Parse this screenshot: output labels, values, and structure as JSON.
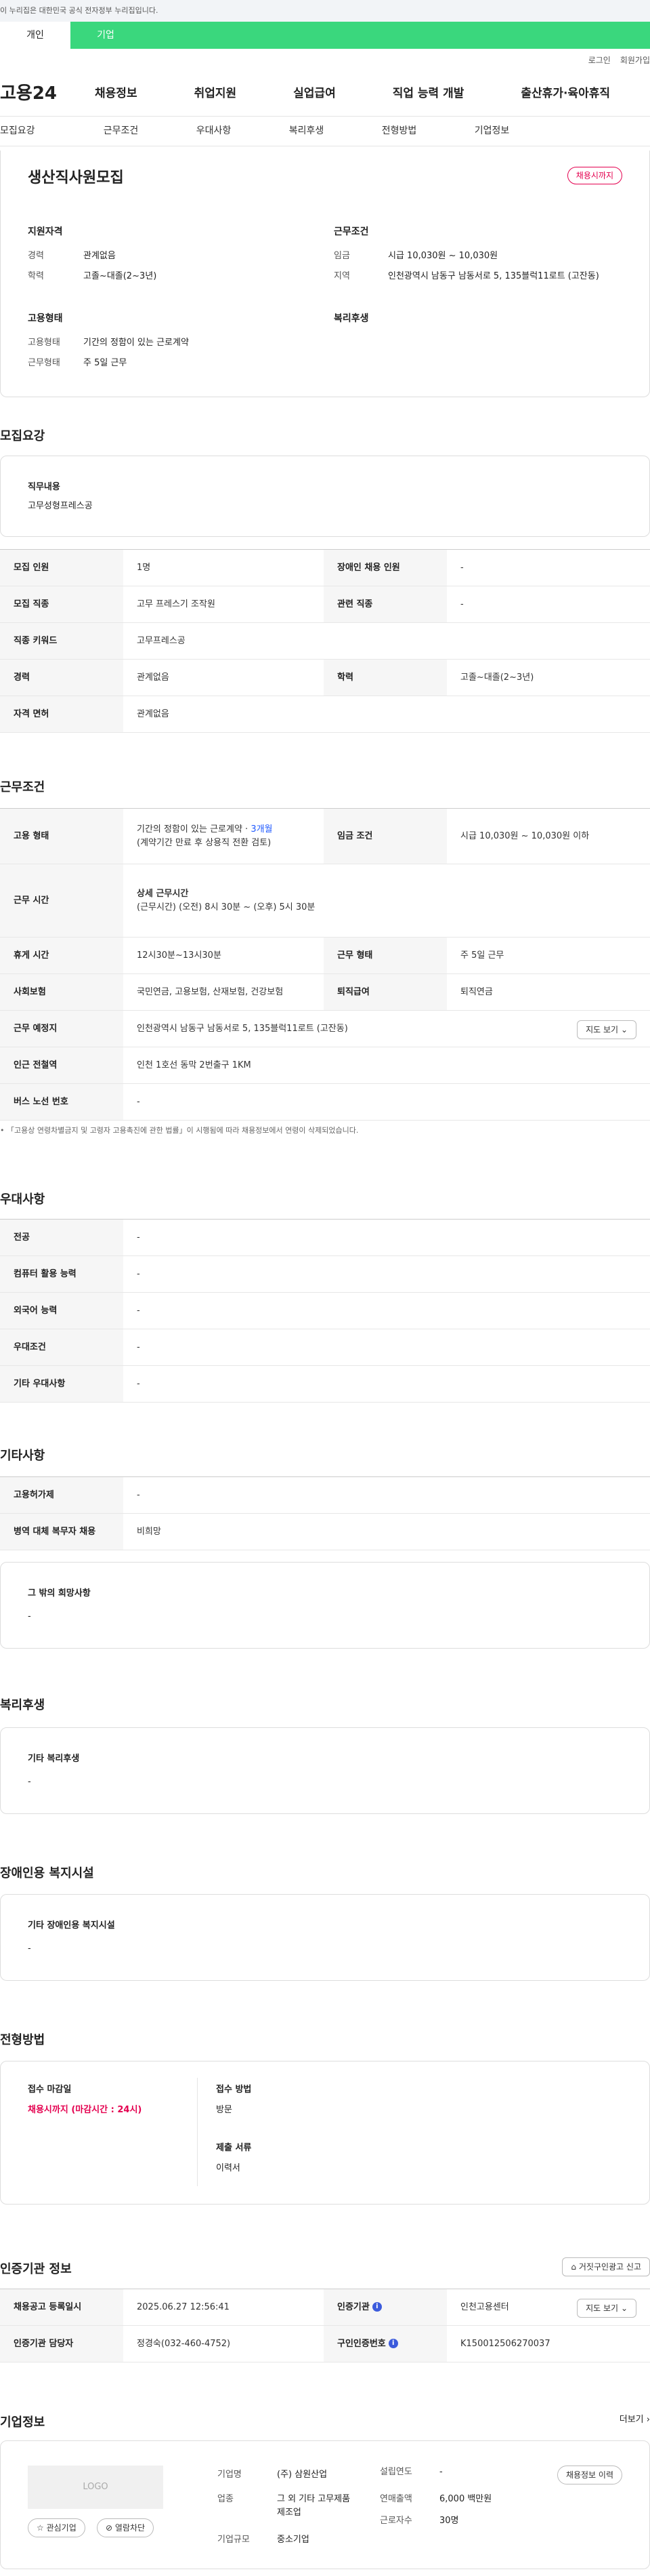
{
  "gov_banner": "이 누리집은 대한민국 공식 전자정부 누리집입니다.",
  "top_tabs": [
    "개인",
    "기업"
  ],
  "util": [
    "로그인",
    "회원가입"
  ],
  "logo": "고용24",
  "gnb": [
    "채용정보",
    "취업지원",
    "실업급여",
    "직업 능력 개발",
    "출산휴가·육아휴직"
  ],
  "anchors": [
    "모집요강",
    "근무조건",
    "우대사항",
    "복리후생",
    "전형방법",
    "기업정보"
  ],
  "job": {
    "title": "생산직사원모집",
    "badge": "채용시까지"
  },
  "summary": {
    "qual_title": "지원자격",
    "career_l": "경력",
    "career_v": "관계없음",
    "edu_l": "학력",
    "edu_v": "고졸~대졸(2~3년)",
    "emp_title": "고용형태",
    "emptype_l": "고용형태",
    "emptype_v": "기간의 정함이 있는 근로계약",
    "worktype_l": "근무형태",
    "worktype_v": "주 5일 근무",
    "cond_title": "근무조건",
    "wage_l": "임금",
    "wage_v": "시급 10,030원 ~ 10,030원",
    "region_l": "지역",
    "region_v": "인천광역시 남동구 남동서로 5, 135블럭11로트 (고잔동)",
    "welfare_title": "복리후생"
  },
  "recruit": {
    "title": "모집요강",
    "duty_l": "직무내용",
    "duty_v": "고무성형프레스공",
    "rows": [
      [
        "모집 인원",
        "1명",
        "장애인 채용 인원",
        "-"
      ],
      [
        "모집 직종",
        "고무 프레스기 조작원",
        "관련 직종",
        "-"
      ],
      [
        "직종 키워드",
        "고무프레스공"
      ],
      [
        "경력",
        "관계없음",
        "학력",
        "고졸~대졸(2~3년)"
      ],
      [
        "자격 면허",
        "관계없음"
      ]
    ]
  },
  "work": {
    "title": "근무조건",
    "emp_l": "고용 형태",
    "emp_v1": "기간의 정함이 있는 근로계약 · ",
    "emp_months": "3개월",
    "emp_v2": "(계약기간 만료 후 상용직 전환 검토)",
    "wagecond_l": "임금 조건",
    "wagecond_v": "시급 10,030원 ~ 10,030원 이하",
    "hours_l": "근무 시간",
    "hours_h": "상세 근무시간",
    "hours_v": "(근무시간) (오전) 8시 30분 ~ (오후) 5시 30분",
    "break_l": "휴게 시간",
    "break_v": "12시30분~13시30분",
    "form_l": "근무 형태",
    "form_v": "주 5일 근무",
    "ins_l": "사회보험",
    "ins_v": "국민연금, 고용보험, 산재보험, 건강보험",
    "ret_l": "퇴직급여",
    "ret_v": "퇴직연금",
    "place_l": "근무 예정지",
    "place_v": "인천광역시 남동구 남동서로 5, 135블럭11로트 (고잔동)",
    "map_btn": "지도 보기",
    "subway_l": "인근 전철역",
    "subway_v": "인천 1호선 동막 2번출구 1KM",
    "bus_l": "버스 노선 번호",
    "bus_v": "-",
    "note": "「고용상 연령차별금지 및 고령자 고용촉진에 관한 법률」이 시행됨에 따라 채용정보에서 연령이 삭제되었습니다."
  },
  "pref": {
    "title": "우대사항",
    "rows": [
      [
        "전공",
        "-"
      ],
      [
        "컴퓨터 활용 능력",
        "-"
      ],
      [
        "외국어 능력",
        "-"
      ],
      [
        "우대조건",
        "-"
      ],
      [
        "기타 우대사항",
        "-"
      ]
    ]
  },
  "etc": {
    "title": "기타사항",
    "rows": [
      [
        "고용허가제",
        "-"
      ],
      [
        "병역 대체 복무자 채용",
        "비희망"
      ]
    ],
    "other_l": "그 밖의 희망사항",
    "other_v": "-"
  },
  "welfare": {
    "title": "복리후생",
    "box_l": "기타 복리후생",
    "box_v": "-"
  },
  "disabled": {
    "title": "장애인용 복지시설",
    "box_l": "기타 장애인용 복지시설",
    "box_v": "-"
  },
  "screening": {
    "title": "전형방법",
    "deadline_l": "접수 마감일",
    "deadline_v": "채용시까지 (마감시간 : 24시)",
    "method_l": "접수 방법",
    "method_v": "방문",
    "docs_l": "제출 서류",
    "docs_v": "이력서"
  },
  "agency": {
    "title": "인증기관 정보",
    "report_btn": "거짓구인광고 신고",
    "reg_l": "채용공고 등록일시",
    "reg_v": "2025.06.27 12:56:41",
    "org_l": "인증기관",
    "org_v": "인천고용센터",
    "map_btn": "지도 보기",
    "mgr_l": "인증기관 담당자",
    "mgr_v": "정경숙(032-460-4752)",
    "no_l": "구인인증번호",
    "no_v": "K150012506270037"
  },
  "company": {
    "title": "기업정보",
    "more": "더보기",
    "logo": "LOGO",
    "fav": "관심기업",
    "block": "열람차단",
    "name_l": "기업명",
    "name_v": "(주) 삼원산업",
    "ind_l": "업종",
    "ind_v": "그 외 기타 고무제품 제조업",
    "size_l": "기업규모",
    "size_v": "중소기업",
    "est_l": "설립연도",
    "est_v": "-",
    "sales_l": "연매출액",
    "sales_v": "6,000 백만원",
    "emp_l": "근로자수",
    "emp_v": "30명",
    "history_btn": "채용정보 이력"
  }
}
